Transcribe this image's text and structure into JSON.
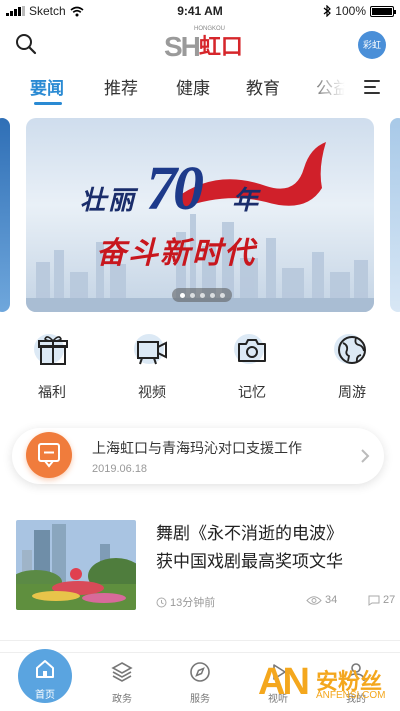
{
  "status_bar": {
    "carrier": "Sketch",
    "time": "9:41 AM",
    "battery": "100%"
  },
  "header": {
    "logo_latin": "SH",
    "logo_cn": "虹口",
    "logo_en": "HONGKOU",
    "avatar_text": "彩虹"
  },
  "tabs": [
    {
      "label": "要闻",
      "active": true
    },
    {
      "label": "推荐",
      "active": false
    },
    {
      "label": "健康",
      "active": false
    },
    {
      "label": "教育",
      "active": false
    },
    {
      "label": "公益",
      "active": false
    }
  ],
  "banner": {
    "line1_a": "壮丽",
    "line1_num": "70",
    "line1_b": "年",
    "line2": "奋斗新时代",
    "slide_count": 5,
    "active_slide": 0
  },
  "quick_links": [
    {
      "label": "福利",
      "icon": "gift-icon"
    },
    {
      "label": "视频",
      "icon": "video-camera-icon"
    },
    {
      "label": "记忆",
      "icon": "camera-icon"
    },
    {
      "label": "周游",
      "icon": "globe-icon"
    }
  ],
  "ticker": {
    "title": "上海虹口与青海玛沁对口支援工作",
    "date": "2019.06.18"
  },
  "article": {
    "title_line1": "舞剧《永不消逝的电波》",
    "title_line2": "获中国戏剧最高奖项文华",
    "time_ago": "13分钟前",
    "views": "34",
    "comments": "27"
  },
  "bottom_nav": [
    {
      "label": "首页",
      "icon": "home-icon",
      "active": true
    },
    {
      "label": "政务",
      "icon": "layers-icon",
      "active": false
    },
    {
      "label": "服务",
      "icon": "compass-icon",
      "active": false
    },
    {
      "label": "视听",
      "icon": "play-icon",
      "active": false
    },
    {
      "label": "我的",
      "icon": "user-icon",
      "active": false
    }
  ],
  "watermark": {
    "brand": "AN",
    "cn": "安粉丝",
    "url": "ANFENSI.COM"
  },
  "colors": {
    "accent": "#2a8ad3",
    "orange": "#f07c3c",
    "red": "#d6262b"
  }
}
